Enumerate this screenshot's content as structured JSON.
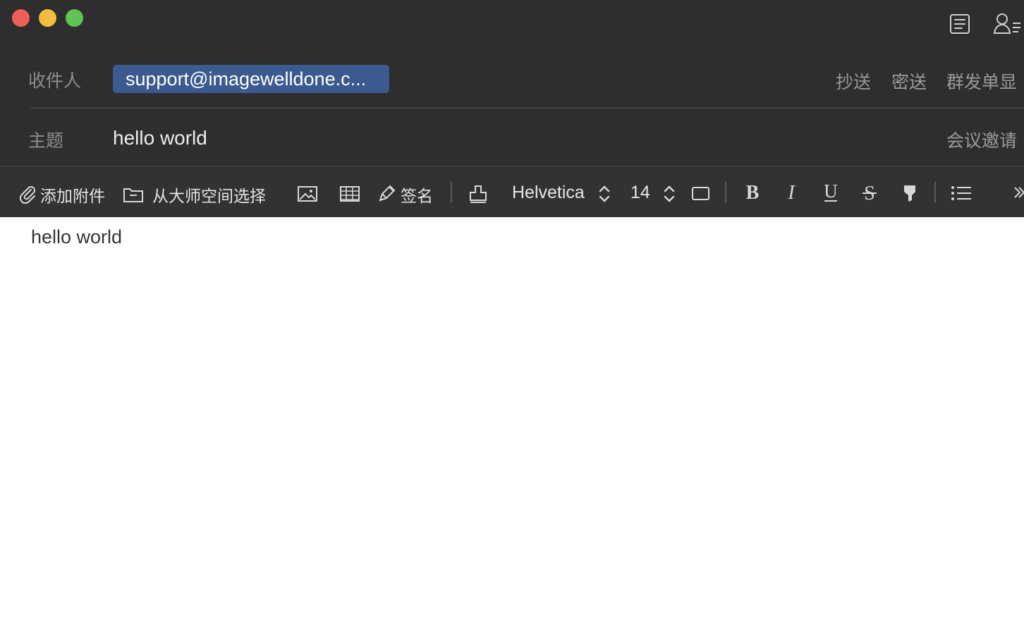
{
  "window": {
    "controls": [
      "close",
      "minimize",
      "maximize"
    ]
  },
  "top_icons": [
    {
      "name": "address-book-icon"
    },
    {
      "name": "contacts-icon"
    }
  ],
  "compose": {
    "to_label": "收件人",
    "recipient_chip": "support@imagewelldone.c...",
    "cc": "抄送",
    "bcc": "密送",
    "separate_send": "群发单显",
    "subject_label": "主题",
    "subject_value": "hello world",
    "meeting_invite": "会议邀请"
  },
  "toolbar": {
    "attach": "添加附件",
    "from_space": "从大师空间选择",
    "signature": "签名",
    "font": "Helvetica",
    "font_size": "14",
    "icons": [
      "paperclip-icon",
      "folder-icon",
      "image-icon",
      "table-icon",
      "pencil-icon",
      "stamp-icon",
      "font-stepper-icon",
      "size-stepper-icon",
      "text-box-icon",
      "bold-icon",
      "italic-icon",
      "underline-icon",
      "strikethrough-icon",
      "highlight-icon",
      "list-icon",
      "more-icon"
    ]
  },
  "body": {
    "text": "hello world"
  },
  "colors": {
    "header": "#2e2e2e",
    "toolbar": "#323232",
    "recipient_chip": "#3b5a8f",
    "close": "#ee5f57",
    "minimize": "#f5bd3f",
    "maximize": "#5fc454"
  }
}
